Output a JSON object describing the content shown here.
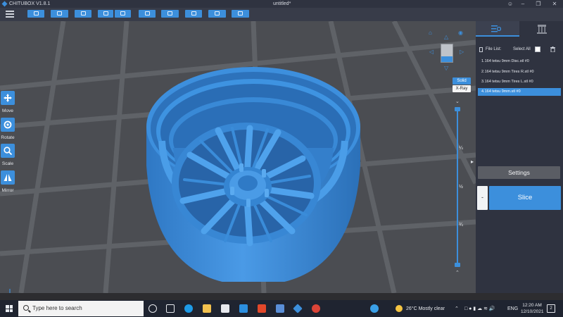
{
  "titlebar": {
    "app_title": "CHITUBOX V1.8.1",
    "doc_title": "untitled*"
  },
  "toolbar": {
    "buttons": [
      "open-file",
      "save-file",
      "auto-layout",
      "undo",
      "redo",
      "screenshot",
      "supports",
      "hollow",
      "dig-hole",
      "calibration"
    ]
  },
  "left_tools": [
    {
      "label": "Move",
      "icon": "move-icon"
    },
    {
      "label": "Rotate",
      "icon": "rotate-icon"
    },
    {
      "label": "Scale",
      "icon": "scale-icon"
    },
    {
      "label": "Mirror",
      "icon": "mirror-icon"
    }
  ],
  "view": {
    "modes": [
      "Solid",
      "X-Ray"
    ],
    "fractions": [
      "¼",
      "½",
      "¾"
    ]
  },
  "panel": {
    "file_list_label": "File List:",
    "select_all_label": "Select All",
    "files": [
      "1.164 tetsu 9mm Disc.stl #0",
      "2.164 tetsu 9mm Tires R.stl #0",
      "3.164 tetsu 9mm Tires L.stl #0",
      "4.164 tetsu 9mm.stl #0"
    ],
    "selected_index": 3,
    "settings_label": "Settings",
    "slice_label": "Slice",
    "minus_label": "-"
  },
  "taskbar": {
    "search_placeholder": "Type here to search",
    "weather": "26°C  Mostly clear",
    "language": "ENG",
    "time": "12:20 AM",
    "date": "12/10/2021",
    "notifications": "2"
  },
  "colors": {
    "accent": "#3c8fdc",
    "model": "#3a8ddb",
    "viewport_bg": "#4b4d52",
    "panel_bg": "#2f3340"
  }
}
